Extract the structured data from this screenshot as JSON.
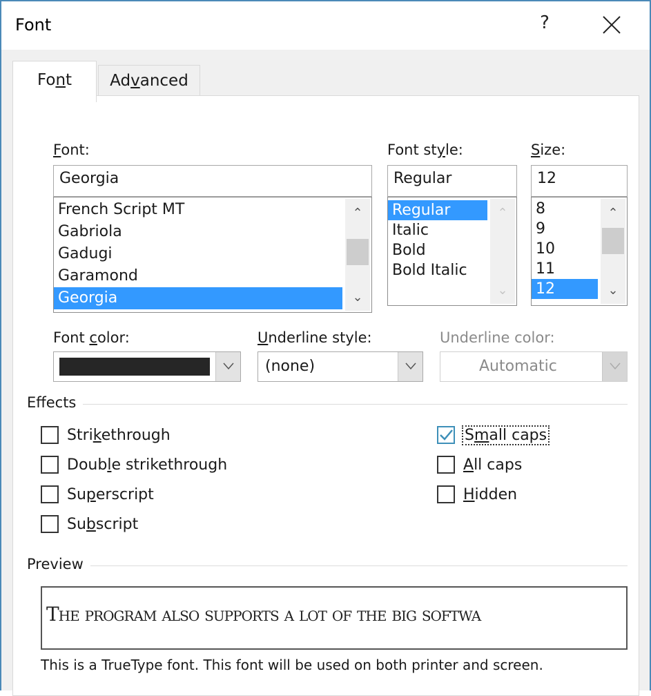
{
  "window": {
    "title": "Font",
    "help_label": "?",
    "close_icon": "close-icon"
  },
  "tabs": [
    {
      "label_pre": "Fo",
      "label_ul": "n",
      "label_post": "t",
      "active": true
    },
    {
      "label_pre": "Ad",
      "label_ul": "v",
      "label_post": "anced",
      "active": false
    }
  ],
  "font": {
    "label_ul": "F",
    "label_post": "ont:",
    "value": "Georgia",
    "list": [
      "French Script MT",
      "Gabriola",
      "Gadugi",
      "Garamond",
      "Georgia"
    ],
    "selected": "Georgia"
  },
  "font_style": {
    "label_pre": "Font st",
    "label_ul": "y",
    "label_post": "le:",
    "value": "Regular",
    "list": [
      "Regular",
      "Italic",
      "Bold",
      "Bold Italic"
    ],
    "selected": "Regular"
  },
  "size": {
    "label_ul": "S",
    "label_post": "ize:",
    "value": "12",
    "list": [
      "8",
      "9",
      "10",
      "11",
      "12"
    ],
    "selected": "12"
  },
  "font_color": {
    "label_pre": "Font ",
    "label_ul": "c",
    "label_post": "olor:",
    "swatch_color": "#262626"
  },
  "underline_style": {
    "label_ul": "U",
    "label_post": "nderline style:",
    "value": "(none)"
  },
  "underline_color": {
    "label": "Underline color:",
    "value": "Automatic",
    "disabled": true
  },
  "effects": {
    "title": "Effects",
    "left": [
      {
        "pre": "Stri",
        "ul": "k",
        "post": "ethrough",
        "checked": false
      },
      {
        "pre": "Doub",
        "ul": "l",
        "post": "e strikethrough",
        "checked": false
      },
      {
        "pre": "Su",
        "ul": "p",
        "post": "erscript",
        "checked": false
      },
      {
        "pre": "Su",
        "ul": "b",
        "post": "script",
        "checked": false
      }
    ],
    "right": [
      {
        "pre": "S",
        "ul": "m",
        "post": "all caps",
        "checked": true
      },
      {
        "pre": "",
        "ul": "A",
        "post": "ll caps",
        "checked": false
      },
      {
        "pre": "",
        "ul": "H",
        "post": "idden",
        "checked": false
      }
    ]
  },
  "preview": {
    "title": "Preview",
    "text": "The program also supports a lot of the big softwa",
    "info": "This is a TrueType font. This font will be used on both printer and screen."
  },
  "colors": {
    "selection": "#3399ff",
    "window_border": "#4a89b8",
    "check": "#3d8fb8"
  }
}
